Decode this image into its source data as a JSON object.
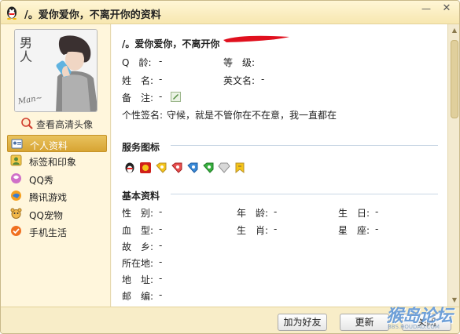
{
  "window": {
    "title": "/。爱你爱你，不离开你的资料",
    "min_label": "—",
    "close_label": "✕"
  },
  "sidebar": {
    "avatar_text_1": "男人",
    "avatar_text_2": "Man~",
    "view_hd_label": "查看高清头像",
    "items": [
      {
        "label": "个人资料",
        "icon": "id-card-icon",
        "active": true
      },
      {
        "label": "标签和印象",
        "icon": "tag-person-icon"
      },
      {
        "label": "QQ秀",
        "icon": "qq-show-icon"
      },
      {
        "label": "腾讯游戏",
        "icon": "game-icon"
      },
      {
        "label": "QQ宠物",
        "icon": "pet-icon"
      },
      {
        "label": "手机生活",
        "icon": "check-icon"
      }
    ]
  },
  "profile": {
    "name": "/。爱你爱你，不离开你",
    "fields": {
      "q_age_label": "Q　龄:",
      "q_age_value": "-",
      "level_label": "等　级:",
      "level_value": "",
      "name_label": "姓　名:",
      "name_value": "-",
      "en_name_label": "英文名:",
      "en_name_value": "-",
      "note_label": "备　注:",
      "note_value": "-",
      "signature_label": "个性签名:",
      "signature_value": "守候，就是不管你在不在意，我一直都在"
    }
  },
  "services": {
    "heading": "服务图标",
    "icons": [
      "qq-penguin-icon",
      "red-box-icon",
      "yellow-diamond-icon",
      "red-diamond-icon",
      "blue-diamond-icon",
      "green-diamond-icon",
      "gray-diamond-icon",
      "yellow-tag-icon"
    ]
  },
  "basic": {
    "heading": "基本资料",
    "gender_label": "性　别:",
    "gender_value": "-",
    "age_label": "年　龄:",
    "age_value": "-",
    "birthday_label": "生　日:",
    "birthday_value": "-",
    "blood_label": "血　型:",
    "blood_value": "-",
    "zodiac_label": "生　肖:",
    "zodiac_value": "-",
    "star_label": "星　座:",
    "star_value": "-",
    "hometown_label": "故　乡:",
    "hometown_value": "-",
    "location_label": "所在地:",
    "location_value": "-",
    "address_label": "地　址:",
    "address_value": "-",
    "postcode_label": "邮　编:",
    "postcode_value": "-"
  },
  "footer": {
    "add_friend": "加为好友",
    "refresh": "更新",
    "close": "关闭"
  },
  "watermark": {
    "text": "猴岛论坛",
    "url": "BBS.HOUDAO.COM"
  },
  "colors": {
    "accent": "#d7a433",
    "title_bg": "#f7e7b0",
    "section_line": "#c8d6e4"
  }
}
